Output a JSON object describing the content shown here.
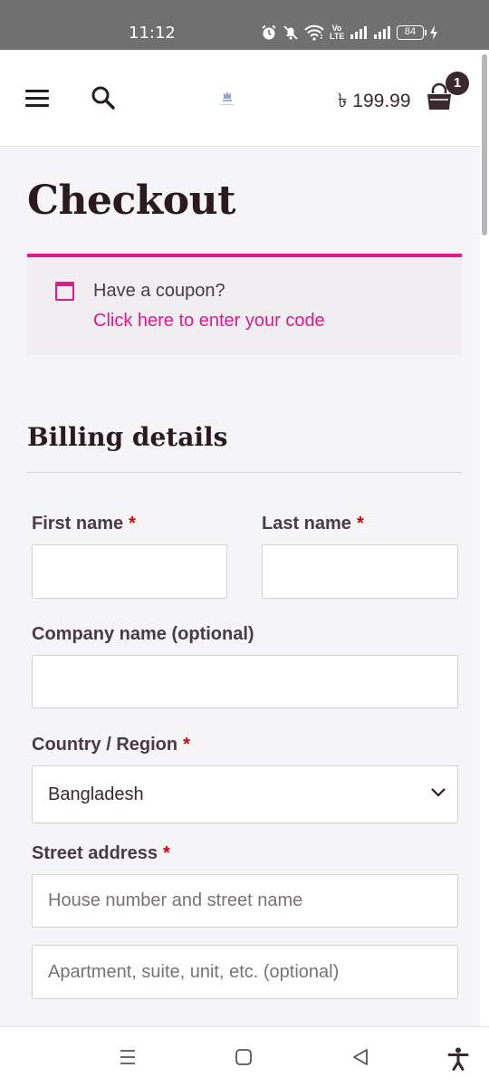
{
  "status_bar": {
    "time": "11:12",
    "volte_label": "Vo LTE",
    "battery": "84"
  },
  "header": {
    "menu_icon": "hamburger-menu-icon",
    "search_icon": "search-icon",
    "logo": "store-logo",
    "cart_total": "৳ 199.99",
    "cart_icon": "shopping-bag-icon",
    "cart_count": "1"
  },
  "page": {
    "title": "Checkout"
  },
  "coupon": {
    "prompt": "Have a coupon?",
    "link": "Click here to enter your code",
    "accent_color": "#e6168d"
  },
  "billing": {
    "title": "Billing details",
    "required_mark": "*",
    "first_name": {
      "label": "First name",
      "value": ""
    },
    "last_name": {
      "label": "Last name",
      "value": ""
    },
    "company": {
      "label": "Company name (optional)",
      "value": ""
    },
    "country": {
      "label": "Country / Region",
      "selected": "Bangladesh"
    },
    "street": {
      "label": "Street address",
      "line1_placeholder": "House number and street name",
      "line2_placeholder": "Apartment, suite, unit, etc. (optional)"
    }
  },
  "nav_bar": {
    "recents_icon": "recent-apps-icon",
    "home_icon": "home-icon",
    "back_icon": "back-icon",
    "accessibility_icon": "accessibility-icon"
  }
}
